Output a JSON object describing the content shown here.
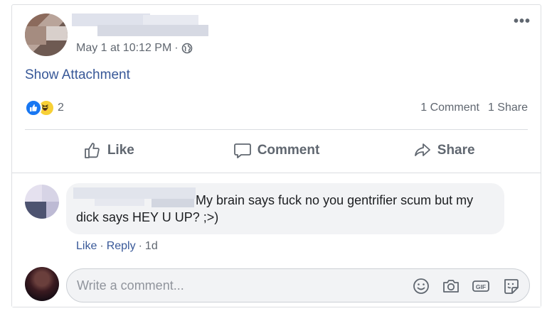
{
  "post": {
    "timestamp": "May 1 at 10:12 PM",
    "separator": "·",
    "privacy_icon": "globe-icon",
    "menu_icon": "more-icon",
    "menu_label": "•••",
    "attachment_link": "Show Attachment"
  },
  "reactions": {
    "icons": [
      "like-icon",
      "haha-icon"
    ],
    "count": "2",
    "comments": "1 Comment",
    "shares": "1 Share"
  },
  "actions": {
    "like": "Like",
    "comment": "Comment",
    "share": "Share"
  },
  "comment": {
    "text": "My brain says fuck no you gentrifier scum but my dick says HEY U UP? ;>)",
    "like": "Like",
    "reply": "Reply",
    "sep": "·",
    "age": "1d"
  },
  "composer": {
    "placeholder": "Write a comment...",
    "tools": [
      "emoji-icon",
      "camera-icon",
      "gif-icon",
      "sticker-icon"
    ],
    "gif_label": "GIF"
  },
  "colors": {
    "link": "#385898",
    "like_blue": "#1877f2",
    "haha_yellow": "#f7d036",
    "muted": "#606770"
  }
}
